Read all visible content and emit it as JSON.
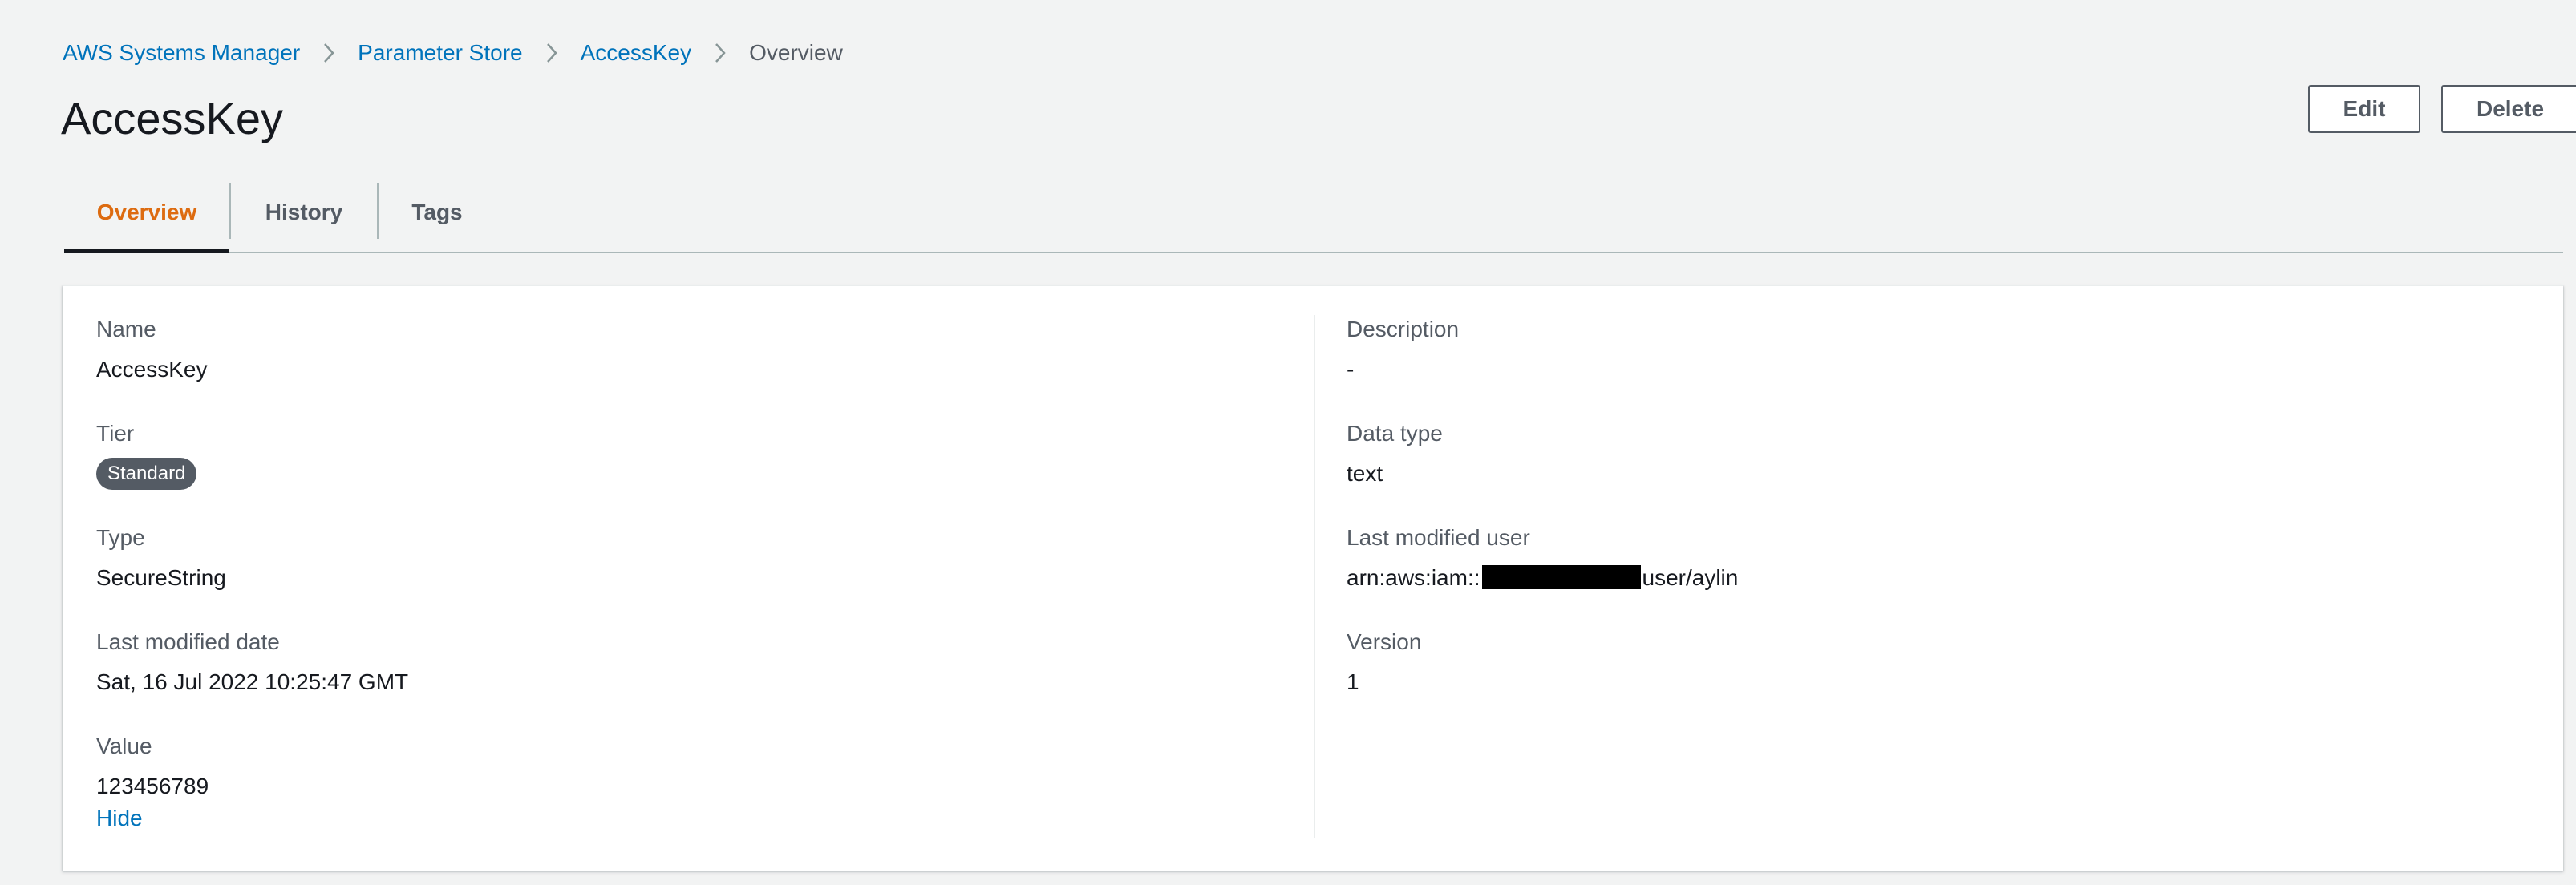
{
  "breadcrumb": {
    "items": [
      "AWS Systems Manager",
      "Parameter Store",
      "AccessKey"
    ],
    "current": "Overview"
  },
  "page": {
    "title": "AccessKey"
  },
  "actions": {
    "edit_label": "Edit",
    "delete_label": "Delete"
  },
  "tabs": [
    {
      "label": "Overview",
      "active": true
    },
    {
      "label": "History",
      "active": false
    },
    {
      "label": "Tags",
      "active": false
    }
  ],
  "details": {
    "name": {
      "label": "Name",
      "value": "AccessKey"
    },
    "tier": {
      "label": "Tier",
      "value": "Standard"
    },
    "type": {
      "label": "Type",
      "value": "SecureString"
    },
    "last_modified_date": {
      "label": "Last modified date",
      "value": "Sat, 16 Jul 2022 10:25:47 GMT"
    },
    "value": {
      "label": "Value",
      "value": "123456789",
      "toggle_label": "Hide"
    },
    "description": {
      "label": "Description",
      "value": "-"
    },
    "data_type": {
      "label": "Data type",
      "value": "text"
    },
    "last_modified_user": {
      "label": "Last modified user",
      "value_prefix": "arn:aws:iam::",
      "value_suffix": "user/aylin"
    },
    "version": {
      "label": "Version",
      "value": "1"
    }
  },
  "colors": {
    "link": "#0073bb",
    "active_tab": "#dd6b10",
    "background": "#f2f3f3",
    "badge": "#545b64"
  }
}
